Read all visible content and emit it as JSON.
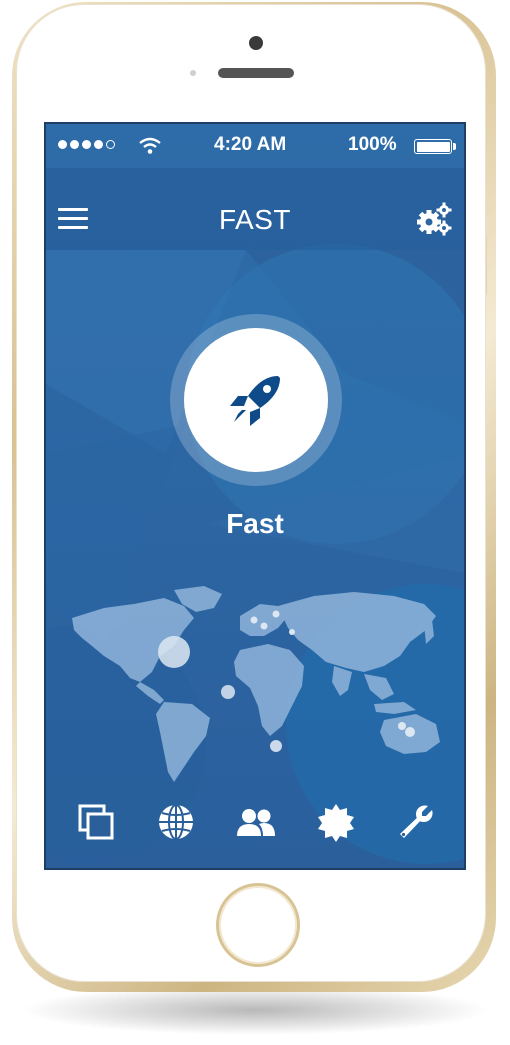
{
  "status_bar": {
    "signal_dots_filled": 4,
    "signal_dots_total": 5,
    "time": "4:20 AM",
    "battery_percent": "100%"
  },
  "nav_bar": {
    "title": "FAST",
    "left_icon": "hamburger-menu-icon",
    "right_icon": "gears-icon"
  },
  "main": {
    "mode_icon": "rocket-icon",
    "mode_label": "Fast",
    "map": "world-map",
    "server_markers_count": 9
  },
  "tab_bar": {
    "tabs": [
      {
        "icon": "windows-icon"
      },
      {
        "icon": "globe-icon"
      },
      {
        "icon": "users-icon"
      },
      {
        "icon": "badge-icon"
      },
      {
        "icon": "wrench-icon"
      }
    ]
  },
  "colors": {
    "screen_background": "#2f6aa8",
    "accent_dark_blue": "#0f4b88",
    "map_land": "#8fb4da",
    "frame_gold": "#d9c293"
  }
}
